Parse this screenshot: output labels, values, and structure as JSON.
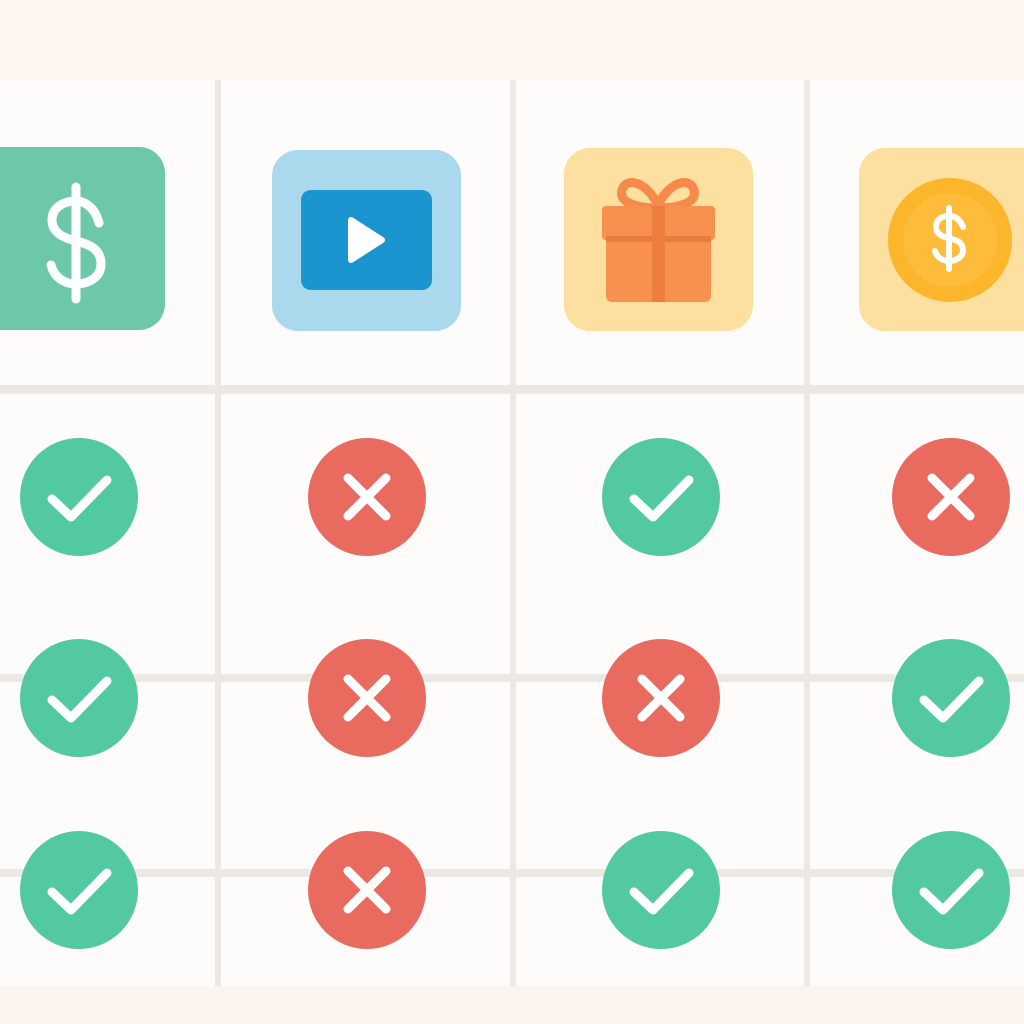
{
  "columns": [
    {
      "icon": "dollar-sign-icon",
      "tile_color": "#6dc8a8"
    },
    {
      "icon": "video-play-icon",
      "tile_color": "#aad8ec"
    },
    {
      "icon": "gift-box-icon",
      "tile_color": "#fddf9f"
    },
    {
      "icon": "coin-dollar-icon",
      "tile_color": "#fddf9f"
    }
  ],
  "rows": [
    [
      "check",
      "cross",
      "check",
      "cross"
    ],
    [
      "check",
      "cross",
      "cross",
      "check"
    ],
    [
      "check",
      "cross",
      "check",
      "check"
    ]
  ],
  "colors": {
    "check": "#52c9a0",
    "cross": "#e96a5f",
    "background": "#fdf8f4",
    "cell": "#fdfcfa",
    "grid_line": "#ece9e5"
  }
}
